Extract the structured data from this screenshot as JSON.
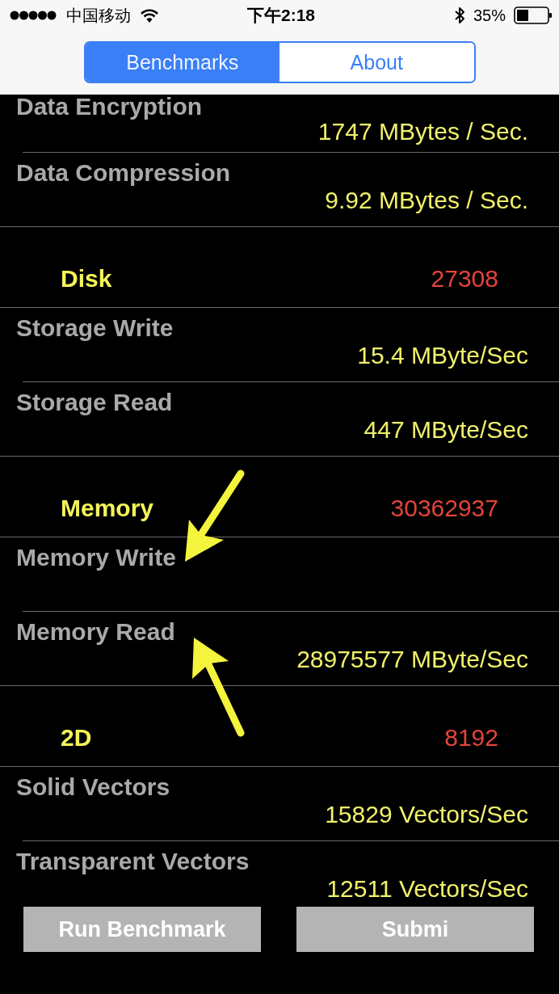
{
  "status_bar": {
    "carrier": "中国移动",
    "time": "下午2:18",
    "battery": "35%"
  },
  "tabs": [
    {
      "label": "Benchmarks",
      "selected": true
    },
    {
      "label": "About",
      "selected": false
    }
  ],
  "rows": [
    {
      "kind": "item",
      "name": "Data Encryption",
      "result": "1747 MBytes / Sec."
    },
    {
      "kind": "item",
      "name": "Data Compression",
      "result": "9.92 MBytes / Sec."
    },
    {
      "kind": "section",
      "name": "Disk",
      "score": "27308"
    },
    {
      "kind": "item",
      "name": "Storage Write",
      "result": "15.4 MByte/Sec"
    },
    {
      "kind": "item",
      "name": "Storage Read",
      "result": "447 MByte/Sec"
    },
    {
      "kind": "section",
      "name": "Memory",
      "score": "30362937"
    },
    {
      "kind": "item",
      "name": "Memory Write"
    },
    {
      "kind": "item",
      "name": "Memory Read",
      "result": "28975577 MByte/Sec"
    },
    {
      "kind": "section",
      "name": "2D",
      "score": "8192"
    },
    {
      "kind": "item",
      "name": "Solid Vectors",
      "result": "15829 Vectors/Sec"
    },
    {
      "kind": "item",
      "name": "Transparent Vectors",
      "result": "12511 Vectors/Sec"
    }
  ],
  "buttons": [
    {
      "label": "Run Benchmark"
    },
    {
      "label": "Submi"
    }
  ]
}
